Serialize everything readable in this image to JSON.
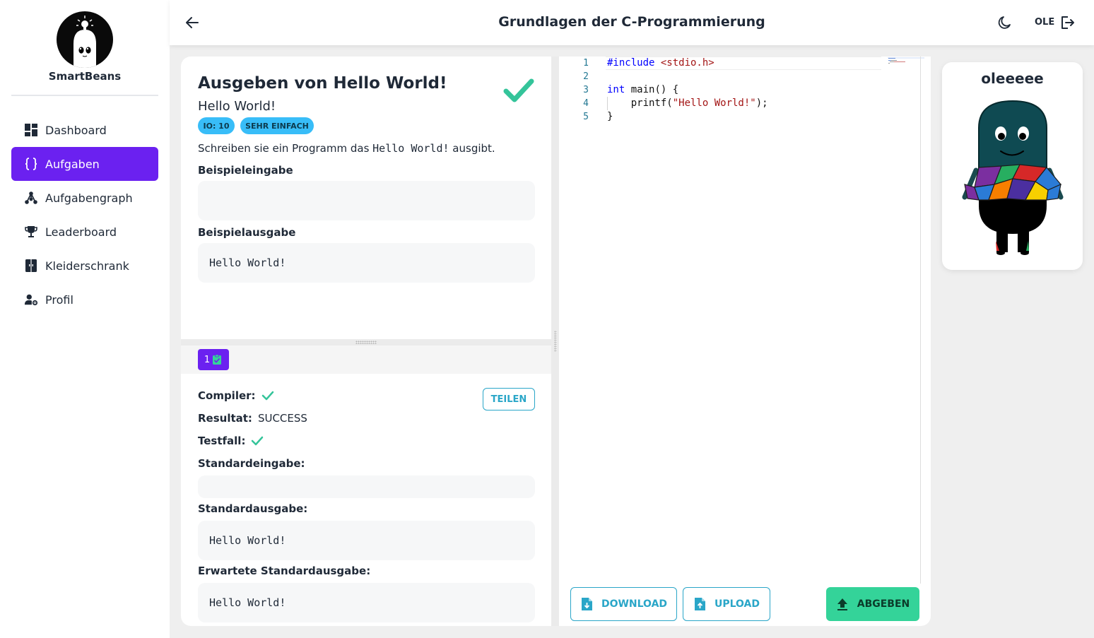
{
  "brand": {
    "name": "SmartBeans"
  },
  "sidebar": {
    "items": [
      {
        "label": "Dashboard",
        "icon": "dashboard-icon"
      },
      {
        "label": "Aufgaben",
        "icon": "curly-braces-icon",
        "active": true
      },
      {
        "label": "Aufgabengraph",
        "icon": "graph-icon"
      },
      {
        "label": "Leaderboard",
        "icon": "trophy-icon"
      },
      {
        "label": "Kleiderschrank",
        "icon": "wardrobe-icon"
      },
      {
        "label": "Profil",
        "icon": "user-settings-icon"
      }
    ]
  },
  "header": {
    "title": "Grundlagen der C-Programmierung",
    "user": "OLE"
  },
  "task": {
    "title": "Ausgeben von Hello World!",
    "subtitle": "Hello World!",
    "badges": [
      "IO: 10",
      "SEHR EINFACH"
    ],
    "description_before": "Schreiben sie ein Programm das ",
    "description_code": "Hello World!",
    "description_after": " ausgibt.",
    "example_input_label": "Beispieleingabe",
    "example_input": "",
    "example_output_label": "Beispielausgabe",
    "example_output": "Hello World!",
    "solved": true
  },
  "result": {
    "tab_label": "1",
    "share_label": "TEILEN",
    "compiler_label": "Compiler:",
    "compiler_ok": true,
    "result_label": "Resultat:",
    "result_value": "SUCCESS",
    "testcase_label": "Testfall:",
    "testcase_ok": true,
    "stdin_label": "Standardeingabe:",
    "stdin_value": "",
    "stdout_label": "Standardausgabe:",
    "stdout_value": "Hello World!",
    "expected_label": "Erwartete Standardausgabe:",
    "expected_value": "Hello World!"
  },
  "editor": {
    "lines": [
      {
        "num": "1",
        "tokens": [
          {
            "t": "#include ",
            "c": "tk-dir"
          },
          {
            "t": "<stdio.h>",
            "c": "tk-inc"
          }
        ]
      },
      {
        "num": "2",
        "tokens": []
      },
      {
        "num": "3",
        "tokens": [
          {
            "t": "int",
            "c": "tk-kw"
          },
          {
            "t": " main() {",
            "c": ""
          }
        ]
      },
      {
        "num": "4",
        "tokens": [
          {
            "t": "    printf(",
            "c": ""
          },
          {
            "t": "\"Hello World!\"",
            "c": "tk-str"
          },
          {
            "t": ");",
            "c": ""
          }
        ]
      },
      {
        "num": "5",
        "tokens": [
          {
            "t": "}",
            "c": ""
          }
        ]
      }
    ],
    "download_label": "DOWNLOAD",
    "upload_label": "UPLOAD",
    "submit_label": "ABGEBEN"
  },
  "avatar": {
    "name": "oleeeee"
  },
  "colors": {
    "accent": "#6b21f0",
    "success": "#34d399",
    "info": "#2aa6c8",
    "badge": "#38bdf8"
  }
}
